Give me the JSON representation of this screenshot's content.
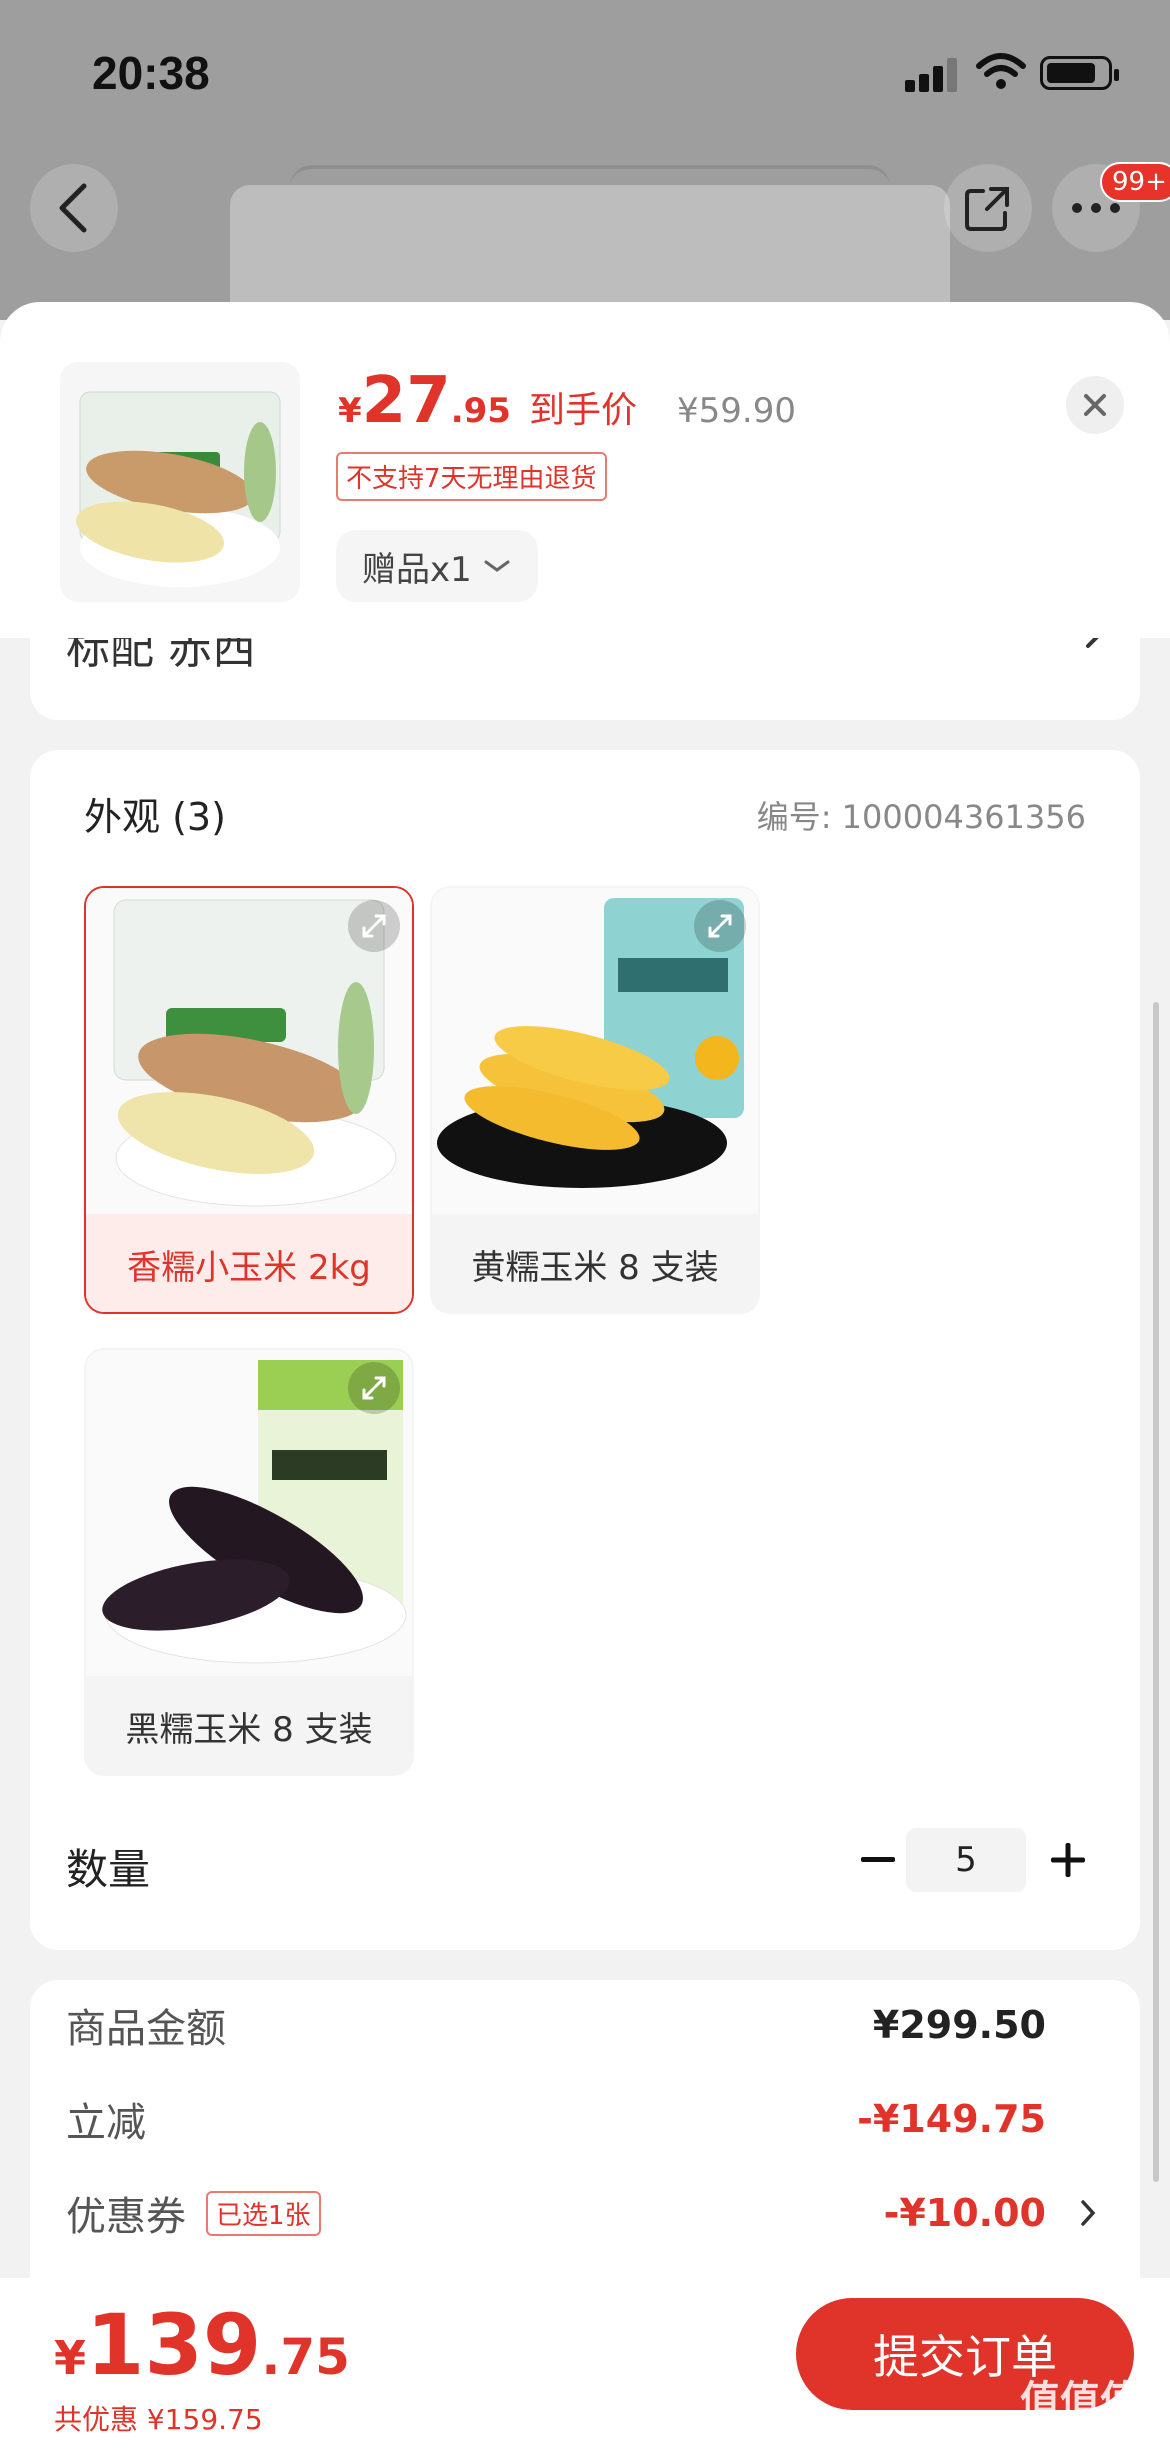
{
  "status_bar": {
    "time": "20:38"
  },
  "nav": {
    "badge": "99+"
  },
  "header": {
    "currency": "¥",
    "price_int": "27",
    "price_dec": ".95",
    "final_label": "到手价",
    "original_price": "¥59.90",
    "no_return_tag": "不支持7天无理由退货",
    "gift_label": "赠品x1"
  },
  "peek": {
    "text": "标配  赤西"
  },
  "variants": {
    "title": "外观 (3)",
    "serial": "编号:  100004361356",
    "options": [
      {
        "label": "香糯小玉米 2kg",
        "selected": true
      },
      {
        "label": "黄糯玉米 8 支装",
        "selected": false
      },
      {
        "label": "黑糯玉米 8 支装",
        "selected": false
      }
    ]
  },
  "quantity": {
    "label": "数量",
    "value": "5"
  },
  "summary": {
    "goods_label": "商品金额",
    "goods_value": "¥299.50",
    "discount_label": "立减",
    "discount_value": "-¥149.75",
    "coupon_label": "优惠券",
    "coupon_tag": "已选1张",
    "coupon_value": "-¥10.00"
  },
  "footer": {
    "currency": "¥",
    "total_int": "139",
    "total_dec": ".75",
    "saved": "共优惠 ¥159.75",
    "submit_label": "提交订单",
    "watermark": "值值值",
    "watermark_url": "zhizhizhi.com"
  },
  "colors": {
    "accent": "#e0332a",
    "background": "#f2f2f2"
  }
}
